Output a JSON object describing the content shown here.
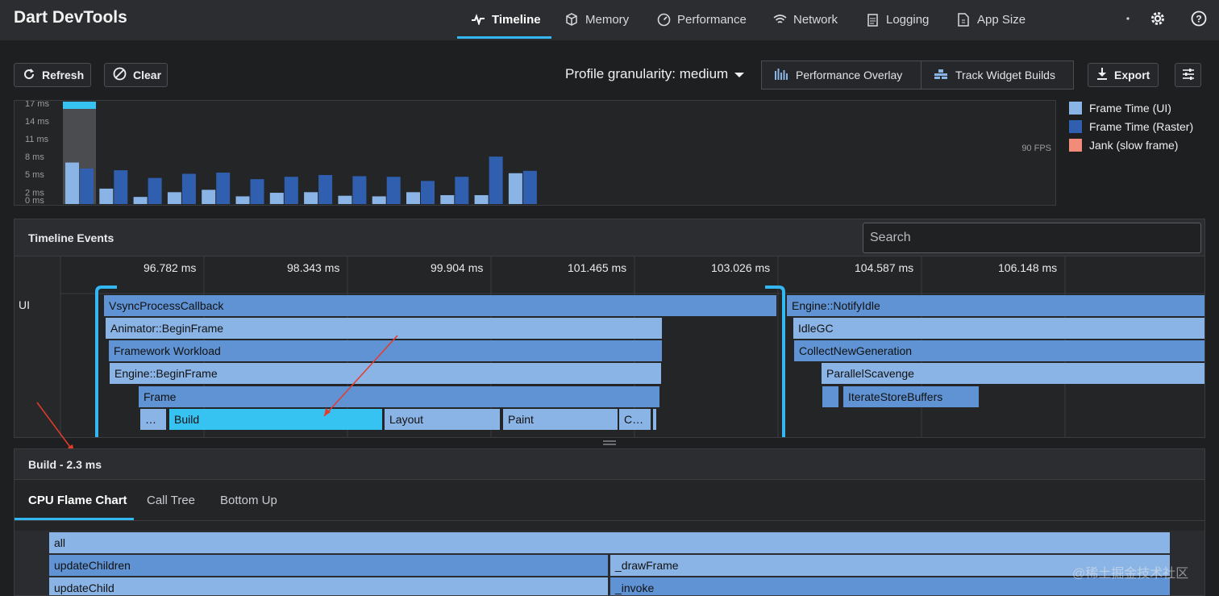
{
  "app": {
    "title": "Dart DevTools"
  },
  "nav": {
    "tabs": [
      {
        "label": "Timeline",
        "icon": "timeline-icon",
        "active": true
      },
      {
        "label": "Memory",
        "icon": "memory-icon"
      },
      {
        "label": "Performance",
        "icon": "performance-icon"
      },
      {
        "label": "Network",
        "icon": "network-icon"
      },
      {
        "label": "Logging",
        "icon": "logging-icon"
      },
      {
        "label": "App Size",
        "icon": "app-size-icon"
      }
    ],
    "right_icons": [
      "status-dot-icon",
      "settings-icon",
      "help-icon"
    ]
  },
  "toolbar": {
    "refresh_label": "Refresh",
    "clear_label": "Clear",
    "granularity_label": "Profile granularity: medium",
    "performance_overlay_label": "Performance Overlay",
    "track_widget_builds_label": "Track Widget Builds",
    "export_label": "Export"
  },
  "frame_chart": {
    "fps_label": "90 FPS",
    "chart_data": {
      "type": "bar",
      "yticks": [
        "17 ms",
        "14 ms",
        "11 ms",
        "8 ms",
        "5 ms",
        "2 ms",
        "0 ms"
      ],
      "ylim": [
        0,
        17
      ],
      "series": [
        {
          "name": "Frame Time (UI)",
          "color": "#8ab4e6",
          "values": [
            7.0,
            2.6,
            1.2,
            2.0,
            2.4,
            1.3,
            1.9,
            2.0,
            1.4,
            1.3,
            2.0,
            1.5,
            1.5,
            5.2
          ]
        },
        {
          "name": "Frame Time (Raster)",
          "color": "#2f5fae",
          "values": [
            6.0,
            5.7,
            4.4,
            5.1,
            5.3,
            4.2,
            4.6,
            4.9,
            4.7,
            4.6,
            3.9,
            4.6,
            8.0,
            5.6
          ]
        }
      ],
      "selected_frame_index": 0
    },
    "legend": [
      {
        "label": "Frame Time (UI)",
        "color": "#8ab4e6"
      },
      {
        "label": "Frame Time (Raster)",
        "color": "#2f5fae"
      },
      {
        "label": "Jank (slow frame)",
        "color": "#f28b79"
      }
    ]
  },
  "timeline_events": {
    "title": "Timeline Events",
    "search_placeholder": "Search",
    "time_labels": [
      "96.782 ms",
      "98.343 ms",
      "99.904 ms",
      "101.465 ms",
      "103.026 ms",
      "104.587 ms",
      "106.148 ms"
    ],
    "row_label": "UI",
    "events": [
      {
        "label": "VsyncProcessCallback",
        "tone": "l1"
      },
      {
        "label": "Animator::BeginFrame",
        "tone": "l2"
      },
      {
        "label": "Framework Workload",
        "tone": "l1"
      },
      {
        "label": "Engine::BeginFrame",
        "tone": "l2"
      },
      {
        "label": "Frame",
        "tone": "l1"
      },
      {
        "label": "…",
        "tone": "l2"
      },
      {
        "label": "Build",
        "tone": "sel"
      },
      {
        "label": "Layout",
        "tone": "l2"
      },
      {
        "label": "Paint",
        "tone": "l2"
      },
      {
        "label": "C…",
        "tone": "l2"
      },
      {
        "label": "",
        "tone": "l2"
      },
      {
        "label": "Engine::NotifyIdle",
        "tone": "l1"
      },
      {
        "label": "IdleGC",
        "tone": "l2"
      },
      {
        "label": "CollectNewGeneration",
        "tone": "l1"
      },
      {
        "label": "ParallelScavenge",
        "tone": "l2"
      },
      {
        "label": "",
        "tone": "l1"
      },
      {
        "label": "IterateStoreBuffers",
        "tone": "l1"
      }
    ]
  },
  "detail": {
    "title": "Build - 2.3 ms",
    "tabs": [
      "CPU Flame Chart",
      "Call Tree",
      "Bottom Up"
    ],
    "flame": [
      {
        "label": "all",
        "tone": "l2"
      },
      {
        "label": "updateChildren",
        "tone": "l1"
      },
      {
        "label": "_drawFrame",
        "tone": "l2"
      },
      {
        "label": "updateChild",
        "tone": "l2"
      },
      {
        "label": "_invoke",
        "tone": "l1"
      }
    ]
  },
  "watermark": "@稀土掘金技术社区"
}
